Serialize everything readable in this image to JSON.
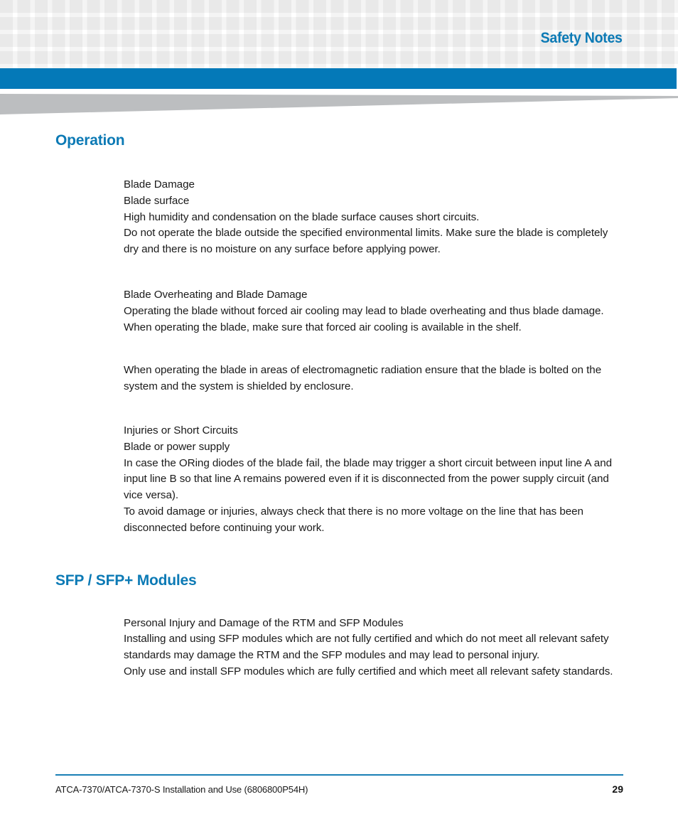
{
  "header": {
    "title": "Safety Notes",
    "accent_color": "#0479b8",
    "title_color": "#0c7ab5",
    "grid_square_color": "#f4f4f4",
    "wedge_color": "#bcbec0"
  },
  "sections": [
    {
      "heading": "Operation",
      "blocks": [
        {
          "lines": [
            "Blade Damage",
            "Blade surface",
            "High humidity and condensation on the blade surface causes short circuits.",
            "Do not operate the blade outside the specified environmental limits. Make sure the blade is completely dry and there is no moisture on any surface before applying power."
          ]
        },
        {
          "lines": [
            "Blade Overheating and Blade Damage",
            "Operating the blade without forced air cooling may lead to blade overheating and thus blade damage.",
            "When operating the blade, make sure that forced air cooling is available in the shelf."
          ]
        },
        {
          "lines": [
            "When operating the blade in areas of electromagnetic radiation ensure that the blade is bolted on the system and the system is shielded by enclosure."
          ]
        },
        {
          "lines": [
            "Injuries or Short Circuits",
            "Blade or power supply",
            "In case the ORing diodes of the blade fail, the blade may trigger a short circuit between input line A and input line B so that line A remains powered even if it is disconnected from the power supply circuit (and vice versa).",
            "To avoid damage or injuries, always check that there is no more voltage on the line that has been disconnected before continuing your work."
          ]
        }
      ]
    },
    {
      "heading": "SFP / SFP+ Modules",
      "blocks": [
        {
          "lines": [
            "Personal Injury and Damage of the RTM and SFP Modules",
            "Installing and using SFP modules which are not fully certified and which do not meet all relevant safety standards may damage the RTM and the SFP modules and may lead to personal injury.",
            "Only use and install SFP modules which are fully certified and which meet all relevant safety standards."
          ]
        }
      ]
    }
  ],
  "footer": {
    "document": "ATCA-7370/ATCA-7370-S Installation and Use (6806800P54H)",
    "page_number": "29",
    "rule_color": "#1a7fb5"
  }
}
